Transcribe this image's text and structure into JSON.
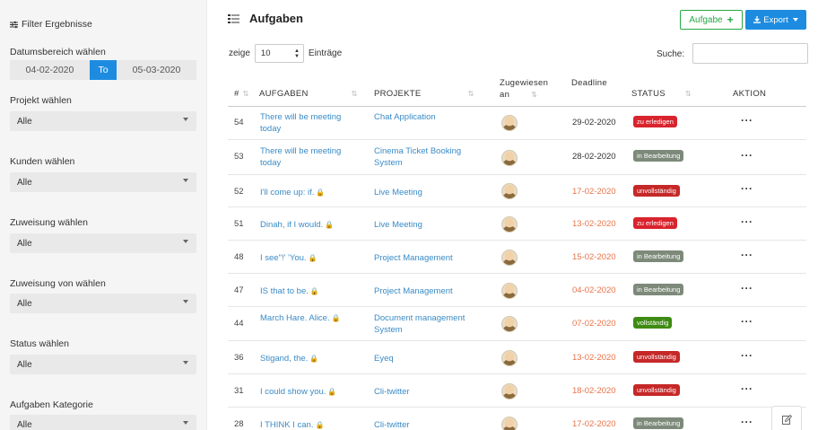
{
  "sidebar": {
    "title": "Filter Ergebnisse",
    "date_label": "Datumsbereich wählen",
    "date_from": "04-02-2020",
    "date_to_label": "To",
    "date_to": "05-03-2020",
    "filters": [
      {
        "label": "Projekt wählen",
        "value": "Alle"
      },
      {
        "label": "Kunden wählen",
        "value": "Alle"
      },
      {
        "label": "Zuweisung wählen",
        "value": "Alle"
      },
      {
        "label": "Zuweisung von wählen",
        "value": "Alle"
      },
      {
        "label": "Status wählen",
        "value": "Alle"
      },
      {
        "label": "Aufgaben Kategorie",
        "value": "Alle"
      }
    ]
  },
  "header": {
    "title": "Aufgaben",
    "add_label": "Aufgabe",
    "export_label": "Export"
  },
  "controls": {
    "show_label": "zeige",
    "entries_value": "10",
    "entries_label": "Einträge",
    "search_label": "Suche:"
  },
  "table": {
    "columns": {
      "id": "#",
      "task": "AUFGABEN",
      "project": "PROJEKTE",
      "assigned_line1": "Zugewiesen",
      "assigned_line2": "an",
      "deadline": "Deadline",
      "status": "STATUS",
      "action": "AKTION"
    },
    "rows": [
      {
        "id": "54",
        "task": "There will be meeting today",
        "project": "Chat Application",
        "deadline": "29-02-2020",
        "overdue": false,
        "status": "zu erledigen",
        "status_color": "#d9232d",
        "locked": false
      },
      {
        "id": "53",
        "task": "There will be meeting today",
        "project": "Cinema Ticket Booking System",
        "deadline": "28-02-2020",
        "overdue": false,
        "status": "in Bearbeitung",
        "status_color": "#7d8a7a",
        "locked": false
      },
      {
        "id": "52",
        "task": "I'll come up: if.",
        "project": "Live Meeting",
        "deadline": "17-02-2020",
        "overdue": true,
        "status": "unvollständig",
        "status_color": "#c62828",
        "locked": true
      },
      {
        "id": "51",
        "task": "Dinah, if I would.",
        "project": "Live Meeting",
        "deadline": "13-02-2020",
        "overdue": true,
        "status": "zu erledigen",
        "status_color": "#d9232d",
        "locked": true
      },
      {
        "id": "48",
        "task": "I see\"!' 'You.",
        "project": "Project Management",
        "deadline": "15-02-2020",
        "overdue": true,
        "status": "in Bearbeitung",
        "status_color": "#7d8a7a",
        "locked": true
      },
      {
        "id": "47",
        "task": "IS that to be.",
        "project": "Project Management",
        "deadline": "04-02-2020",
        "overdue": true,
        "status": "in Bearbeitung",
        "status_color": "#7d8a7a",
        "locked": true
      },
      {
        "id": "44",
        "task": "March Hare. Alice.",
        "project": "Document management System",
        "deadline": "07-02-2020",
        "overdue": true,
        "status": "vollständig",
        "status_color": "#3d8b12",
        "locked": true
      },
      {
        "id": "36",
        "task": "Stigand, the.",
        "project": "Eyeq",
        "deadline": "13-02-2020",
        "overdue": true,
        "status": "unvollständig",
        "status_color": "#c62828",
        "locked": true
      },
      {
        "id": "31",
        "task": "I could show you.",
        "project": "Cli-twitter",
        "deadline": "18-02-2020",
        "overdue": true,
        "status": "unvollständig",
        "status_color": "#c62828",
        "locked": true
      },
      {
        "id": "28",
        "task": "I THINK I can.",
        "project": "Cli-twitter",
        "deadline": "17-02-2020",
        "overdue": true,
        "status": "in Bearbeitung",
        "status_color": "#7d8a7a",
        "locked": true
      }
    ]
  }
}
